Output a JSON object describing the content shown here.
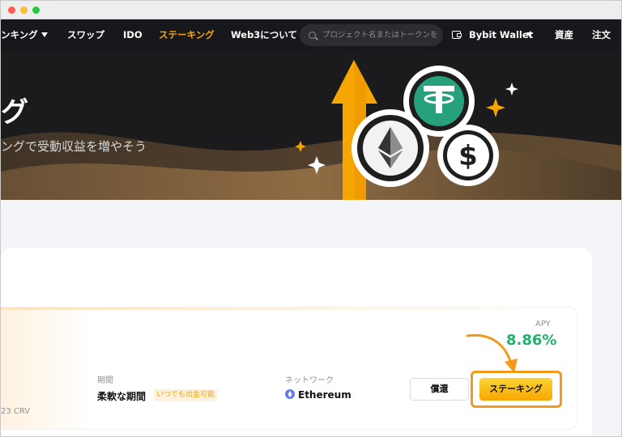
{
  "nav": {
    "items": [
      {
        "label": "ンキング"
      },
      {
        "label": "スワップ"
      },
      {
        "label": "IDO"
      },
      {
        "label": "ステーキング"
      },
      {
        "label": "Web3について"
      }
    ],
    "search_placeholder": "プロジェクト名またはトークンを",
    "wallet_label": "Bybit Wallet",
    "assets_label": "資産",
    "orders_label": "注文"
  },
  "hero": {
    "title": "グ",
    "subtitle": "ングで受動収益を増やそう"
  },
  "product": {
    "apy_label": "APY",
    "apy_value": "8.86%",
    "term_label": "期間",
    "term_value": "柔軟な期間",
    "term_badge": "いつでも出金可能",
    "network_label": "ネットワーク",
    "network_value": "Ethereum",
    "amount_fragment": "23 CRV",
    "redeem_label": "償還",
    "stake_label": "ステーキング"
  },
  "colors": {
    "accent": "#f7a600",
    "apy_green": "#20b26c",
    "nav_bg": "#17181b",
    "highlight": "#f29a1c"
  },
  "icons": {
    "hero": [
      "orange-arrow-icon",
      "ethereum-coin-icon",
      "tether-coin-icon",
      "dollar-coin-icon",
      "sparkle-icon"
    ],
    "nav": [
      "caret-down-icon",
      "search-icon",
      "wallet-icon"
    ],
    "card": [
      "ethereum-network-icon",
      "pointer-arrow-icon"
    ]
  }
}
